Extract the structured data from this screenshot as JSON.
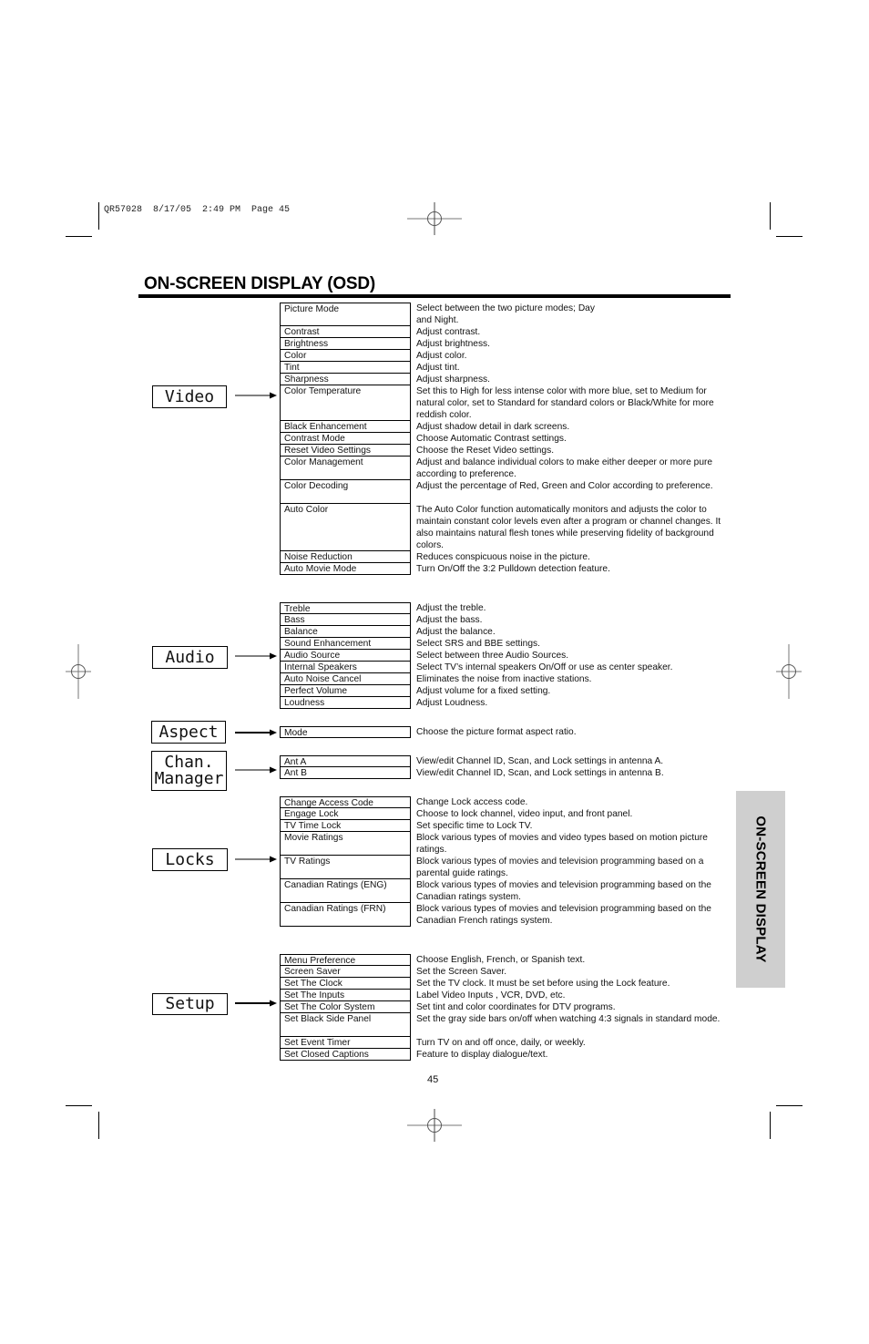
{
  "print_slug": "QR57028  8/17/05  2:49 PM  Page 45",
  "title": "ON-SCREEN DISPLAY (OSD)",
  "side_tab": "ON-SCREEN DISPLAY",
  "page_number": "45",
  "sections": {
    "video": {
      "label": "Video",
      "items": [
        {
          "name": "Picture Mode",
          "desc": "Select between the two picture modes; Day\nand Night."
        },
        {
          "name": "Contrast",
          "desc": "Adjust contrast."
        },
        {
          "name": "Brightness",
          "desc": "Adjust brightness."
        },
        {
          "name": "Color",
          "desc": "Adjust color."
        },
        {
          "name": "Tint",
          "desc": "Adjust tint."
        },
        {
          "name": "Sharpness",
          "desc": "Adjust sharpness."
        },
        {
          "name": "Color Temperature",
          "desc": "Set this to High for less intense color with more blue, set to Medium for natural color, set to Standard for standard colors or Black/White for more reddish color."
        },
        {
          "name": "Black Enhancement",
          "desc": "Adjust shadow detail in dark screens."
        },
        {
          "name": "Contrast Mode",
          "desc": "Choose Automatic Contrast settings."
        },
        {
          "name": "Reset Video Settings",
          "desc": "Choose the Reset Video settings."
        },
        {
          "name": "Color Management",
          "desc": "Adjust and balance individual colors to make either deeper or more pure according to preference."
        },
        {
          "name": "Color Decoding",
          "desc": "Adjust the percentage of Red, Green and Color according to preference."
        },
        {
          "name": "Auto Color",
          "desc": "The Auto Color function automatically monitors and adjusts the color to maintain constant color levels even after a program or channel changes. It also maintains natural flesh tones while preserving fidelity of background colors."
        },
        {
          "name": "Noise Reduction",
          "desc": "Reduces conspicuous noise in the picture."
        },
        {
          "name": "Auto Movie Mode",
          "desc": "Turn On/Off the 3:2 Pulldown detection feature."
        }
      ]
    },
    "audio": {
      "label": "Audio",
      "items": [
        {
          "name": "Treble",
          "desc": "Adjust the treble."
        },
        {
          "name": "Bass",
          "desc": "Adjust the bass."
        },
        {
          "name": "Balance",
          "desc": "Adjust the balance."
        },
        {
          "name": "Sound Enhancement",
          "desc": "Select SRS and BBE settings."
        },
        {
          "name": "Audio Source",
          "desc": "Select between three Audio Sources."
        },
        {
          "name": "Internal Speakers",
          "desc": "Select TV’s internal speakers On/Off or use as center speaker."
        },
        {
          "name": "Auto Noise Cancel",
          "desc": "Eliminates the noise from inactive stations."
        },
        {
          "name": "Perfect Volume",
          "desc": "Adjust volume for a fixed setting."
        },
        {
          "name": "Loudness",
          "desc": "Adjust Loudness."
        }
      ]
    },
    "aspect": {
      "label": "Aspect",
      "items": [
        {
          "name": "Mode",
          "desc": "Choose the picture format aspect ratio."
        }
      ]
    },
    "chan_manager": {
      "label": "Chan.\nManager",
      "items": [
        {
          "name": "Ant A",
          "desc": "View/edit Channel ID, Scan, and Lock settings in antenna A."
        },
        {
          "name": "Ant B",
          "desc": "View/edit Channel ID, Scan, and Lock settings in antenna B."
        }
      ]
    },
    "locks": {
      "label": "Locks",
      "items": [
        {
          "name": "Change Access Code",
          "desc": "Change Lock access code."
        },
        {
          "name": "Engage Lock",
          "desc": "Choose to lock channel, video input, and front panel."
        },
        {
          "name": "TV Time Lock",
          "desc": "Set specific time to Lock TV."
        },
        {
          "name": "Movie Ratings",
          "desc": "Block various types of movies and video types based on motion picture ratings."
        },
        {
          "name": "TV Ratings",
          "desc": "Block various types of movies and television programming based on a parental guide ratings."
        },
        {
          "name": "Canadian Ratings (ENG)",
          "desc": "Block various types of movies and television programming based on the Canadian ratings system."
        },
        {
          "name": "Canadian Ratings (FRN)",
          "desc": "Block various types of movies and television programming based on the Canadian French ratings system."
        }
      ]
    },
    "setup": {
      "label": "Setup",
      "items": [
        {
          "name": "Menu Preference",
          "desc": "Choose English, French, or Spanish text."
        },
        {
          "name": "Screen Saver",
          "desc": "Set the Screen Saver."
        },
        {
          "name": "Set The Clock",
          "desc": "Set the TV clock.  It must be set before using the Lock feature."
        },
        {
          "name": "Set The Inputs",
          "desc": "Label Video Inputs , VCR, DVD, etc."
        },
        {
          "name": "Set The Color System",
          "desc": "Set tint and color coordinates for DTV programs."
        },
        {
          "name": "Set Black Side Panel",
          "desc": "Set the gray side bars on/off when watching 4:3 signals in standard mode."
        },
        {
          "name": "Set Event Timer",
          "desc": "Turn TV on and off once, daily, or weekly."
        },
        {
          "name": "Set Closed Captions",
          "desc": "Feature to display dialogue/text."
        }
      ]
    }
  }
}
